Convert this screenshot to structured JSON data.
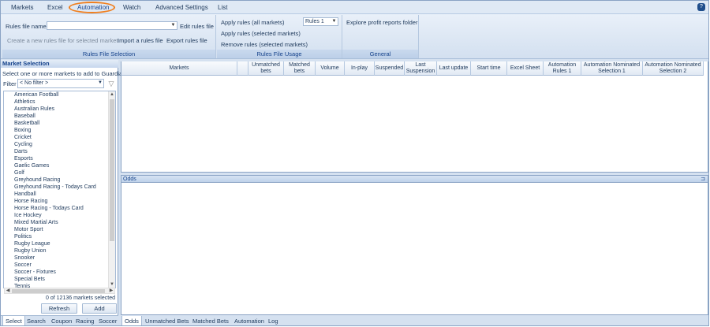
{
  "menu": [
    "Markets",
    "Excel",
    "Automation",
    "Watch",
    "Advanced Settings",
    "List"
  ],
  "ribbon": {
    "rules_file_name_label": "Rules file name",
    "edit_rules_file": "Edit rules file",
    "create_new": "Create a new rules file for selected market",
    "import": "Import a rules file",
    "export": "Export rules file",
    "group1": "Rules File Selection",
    "apply_all": "Apply rules (all markets)",
    "apply_selected": "Apply rules (selected markets)",
    "remove_selected": "Remove rules (selected markets)",
    "rules_value": "Rules 1",
    "group2": "Rules File Usage",
    "explore": "Explore profit reports folder",
    "group3": "General"
  },
  "market_selection": {
    "title": "Market Selection",
    "subtitle": "Select one or more markets to add to Guardian",
    "filter_label": "Filter",
    "filter_value": "< No filter >",
    "items": [
      "American Football",
      "Athletics",
      "Australian Rules",
      "Baseball",
      "Basketball",
      "Boxing",
      "Cricket",
      "Cycling",
      "Darts",
      "Esports",
      "Gaelic Games",
      "Golf",
      "Greyhound Racing",
      "Greyhound Racing - Todays Card",
      "Handball",
      "Horse Racing",
      "Horse Racing - Todays Card",
      "Ice Hockey",
      "Mixed Martial Arts",
      "Motor Sport",
      "Politics",
      "Rugby League",
      "Rugby Union",
      "Snooker",
      "Soccer",
      "Soccer - Fixtures",
      "Special Bets",
      "Tennis"
    ],
    "count": "0 of 12136 markets selected",
    "refresh": "Refresh",
    "add": "Add"
  },
  "left_tabs": [
    "Select",
    "Search",
    "Coupon",
    "Racing",
    "Soccer"
  ],
  "columns": [
    "Markets",
    "Unmatched bets",
    "Matched bets",
    "Volume",
    "In-play",
    "Suspended",
    "Last Suspension",
    "Last update",
    "Start time",
    "Excel Sheet",
    "Automation Rules 1",
    "Automation Nominated Selection 1",
    "Automation Nominated Selection 2"
  ],
  "odds_title": "Odds",
  "bottom_tabs": [
    "Odds",
    "Unmatched Bets",
    "Matched Bets",
    "Automation",
    "Log"
  ],
  "colors": {
    "accent": "#f07f1e",
    "header": "#15428b"
  }
}
